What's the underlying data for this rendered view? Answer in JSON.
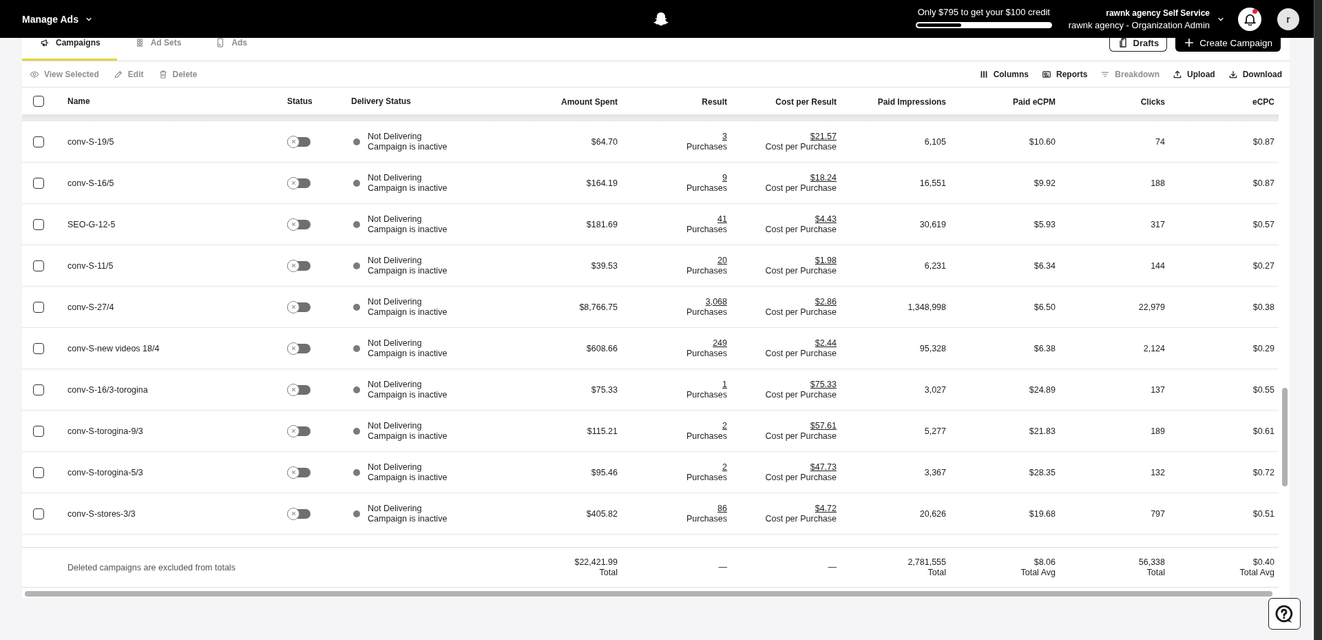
{
  "top_bar": {
    "menu_title": "Manage Ads",
    "credit": {
      "text": "Only $795 to get your $100 credit",
      "level": 0.33
    },
    "account": {
      "name": "rawnk agency Self Service",
      "role": "rawnk agency - Organization Admin"
    },
    "notifications": {
      "unread": true
    },
    "avatar": {
      "initial": "r"
    }
  },
  "tabs": [
    {
      "label": "Campaigns",
      "selected": true
    },
    {
      "label": "Ad Sets",
      "selected": false
    },
    {
      "label": "Ads",
      "selected": false
    }
  ],
  "buttons": [
    {
      "label": "Drafts",
      "kind": "secondary"
    },
    {
      "label": "Create Campaign",
      "kind": "primary"
    }
  ],
  "actions": [
    {
      "label": "View Selected",
      "disabled": true
    },
    {
      "label": "Edit",
      "disabled": true
    },
    {
      "label": "Delete",
      "disabled": true
    }
  ],
  "tools": [
    {
      "label": "Columns",
      "disabled": false
    },
    {
      "label": "Reports",
      "disabled": false
    },
    {
      "label": "Breakdown",
      "disabled": true
    },
    {
      "label": "Upload",
      "disabled": false
    },
    {
      "label": "Download",
      "disabled": false
    }
  ],
  "table": {
    "select_all": {
      "checked": false
    },
    "columns": [
      "Name",
      "Status",
      "Delivery Status",
      "Amount Spent",
      "Result",
      "Cost per Result",
      "Paid Impressions",
      "Paid eCPM",
      "Clicks",
      "eCPC"
    ],
    "rows": [
      {
        "checked": false,
        "name": "conv-S-19/5",
        "enabled": false,
        "delivery": {
          "status": "Not Delivering",
          "detail": "Campaign is inactive",
          "color": "#7a7a7a"
        },
        "amount_spent": "$64.70",
        "result": {
          "value": "3",
          "label": "Purchases"
        },
        "cost_per_result": {
          "value": "$21.57",
          "label": "Cost per Purchase"
        },
        "paid_impressions": "6,105",
        "paid_ecpm": "$10.60",
        "clicks": "74",
        "ecpc": "$0.87"
      },
      {
        "checked": false,
        "name": "conv-S-16/5",
        "enabled": false,
        "delivery": {
          "status": "Not Delivering",
          "detail": "Campaign is inactive",
          "color": "#7a7a7a"
        },
        "amount_spent": "$164.19",
        "result": {
          "value": "9",
          "label": "Purchases"
        },
        "cost_per_result": {
          "value": "$18.24",
          "label": "Cost per Purchase"
        },
        "paid_impressions": "16,551",
        "paid_ecpm": "$9.92",
        "clicks": "188",
        "ecpc": "$0.87"
      },
      {
        "checked": false,
        "name": "SEO-G-12-5",
        "enabled": false,
        "delivery": {
          "status": "Not Delivering",
          "detail": "Campaign is inactive",
          "color": "#7a7a7a"
        },
        "amount_spent": "$181.69",
        "result": {
          "value": "41",
          "label": "Purchases"
        },
        "cost_per_result": {
          "value": "$4.43",
          "label": "Cost per Purchase"
        },
        "paid_impressions": "30,619",
        "paid_ecpm": "$5.93",
        "clicks": "317",
        "ecpc": "$0.57"
      },
      {
        "checked": false,
        "name": "conv-S-11/5",
        "enabled": false,
        "delivery": {
          "status": "Not Delivering",
          "detail": "Campaign is inactive",
          "color": "#7a7a7a"
        },
        "amount_spent": "$39.53",
        "result": {
          "value": "20",
          "label": "Purchases"
        },
        "cost_per_result": {
          "value": "$1.98",
          "label": "Cost per Purchase"
        },
        "paid_impressions": "6,231",
        "paid_ecpm": "$6.34",
        "clicks": "144",
        "ecpc": "$0.27"
      },
      {
        "checked": false,
        "name": "conv-S-27/4",
        "enabled": false,
        "delivery": {
          "status": "Not Delivering",
          "detail": "Campaign is inactive",
          "color": "#7a7a7a"
        },
        "amount_spent": "$8,766.75",
        "result": {
          "value": "3,068",
          "label": "Purchases"
        },
        "cost_per_result": {
          "value": "$2.86",
          "label": "Cost per Purchase"
        },
        "paid_impressions": "1,348,998",
        "paid_ecpm": "$6.50",
        "clicks": "22,979",
        "ecpc": "$0.38"
      },
      {
        "checked": false,
        "name": "conv-S-new videos 18/4",
        "enabled": false,
        "delivery": {
          "status": "Not Delivering",
          "detail": "Campaign is inactive",
          "color": "#7a7a7a"
        },
        "amount_spent": "$608.66",
        "result": {
          "value": "249",
          "label": "Purchases"
        },
        "cost_per_result": {
          "value": "$2.44",
          "label": "Cost per Purchase"
        },
        "paid_impressions": "95,328",
        "paid_ecpm": "$6.38",
        "clicks": "2,124",
        "ecpc": "$0.29"
      },
      {
        "checked": false,
        "name": "conv-S-16/3-torogina",
        "enabled": false,
        "delivery": {
          "status": "Not Delivering",
          "detail": "Campaign is inactive",
          "color": "#7a7a7a"
        },
        "amount_spent": "$75.33",
        "result": {
          "value": "1",
          "label": "Purchases"
        },
        "cost_per_result": {
          "value": "$75.33",
          "label": "Cost per Purchase"
        },
        "paid_impressions": "3,027",
        "paid_ecpm": "$24.89",
        "clicks": "137",
        "ecpc": "$0.55"
      },
      {
        "checked": false,
        "name": "conv-S-torogina-9/3",
        "enabled": false,
        "delivery": {
          "status": "Not Delivering",
          "detail": "Campaign is inactive",
          "color": "#7a7a7a"
        },
        "amount_spent": "$115.21",
        "result": {
          "value": "2",
          "label": "Purchases"
        },
        "cost_per_result": {
          "value": "$57.61",
          "label": "Cost per Purchase"
        },
        "paid_impressions": "5,277",
        "paid_ecpm": "$21.83",
        "clicks": "189",
        "ecpc": "$0.61"
      },
      {
        "checked": false,
        "name": "conv-S-torogina-5/3",
        "enabled": false,
        "delivery": {
          "status": "Not Delivering",
          "detail": "Campaign is inactive",
          "color": "#7a7a7a"
        },
        "amount_spent": "$95.46",
        "result": {
          "value": "2",
          "label": "Purchases"
        },
        "cost_per_result": {
          "value": "$47.73",
          "label": "Cost per Purchase"
        },
        "paid_impressions": "3,367",
        "paid_ecpm": "$28.35",
        "clicks": "132",
        "ecpc": "$0.72"
      },
      {
        "checked": false,
        "name": "conv-S-stores-3/3",
        "enabled": false,
        "delivery": {
          "status": "Not Delivering",
          "detail": "Campaign is inactive",
          "color": "#7a7a7a"
        },
        "amount_spent": "$405.82",
        "result": {
          "value": "86",
          "label": "Purchases"
        },
        "cost_per_result": {
          "value": "$4.72",
          "label": "Cost per Purchase"
        },
        "paid_impressions": "20,626",
        "paid_ecpm": "$19.68",
        "clicks": "797",
        "ecpc": "$0.51"
      }
    ],
    "totals": {
      "note": "Deleted campaigns are excluded from totals",
      "cells": [
        {
          "value": "$22,421.99",
          "label": "Total"
        },
        {
          "value": "—"
        },
        {
          "value": "—"
        },
        {
          "value": "2,781,555",
          "label": "Total"
        },
        {
          "value": "$8.06",
          "label": "Total Avg"
        },
        {
          "value": "56,338",
          "label": "Total"
        },
        {
          "value": "$0.40",
          "label": "Total Avg"
        }
      ]
    }
  }
}
